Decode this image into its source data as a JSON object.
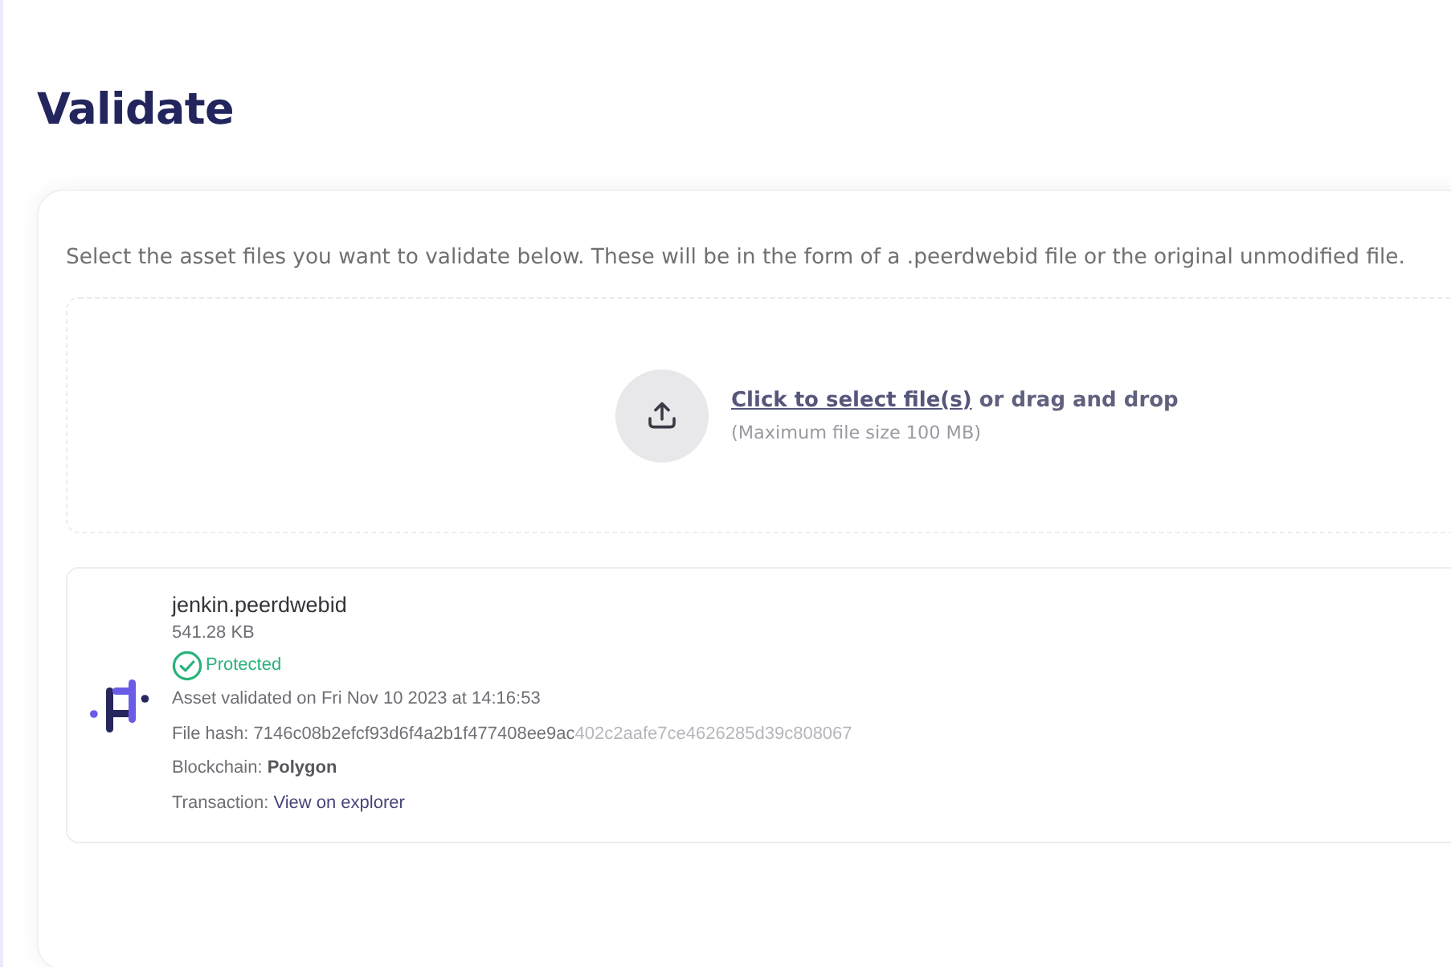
{
  "page": {
    "title": "Validate"
  },
  "upload": {
    "instructions": "Select the asset files you want to validate below. These will be in the form of a .peerdwebid file or the original unmodified file.",
    "link": "Click to select file(s)",
    "prompt": "or drag and drop",
    "limit": "(Maximum file size 100 MB)"
  },
  "files": [
    {
      "name": "jenkin.peerdwebid",
      "size": "541.28 KB",
      "status": {
        "kind": "protected",
        "label": "Protected"
      },
      "validated": "Asset validated on Fri Nov 10 2023 at 14:16:53",
      "hash_label": "File hash:",
      "hash": "7146c08b2efcf93d6f4a2b1f477408ee9ac402c2aafe7ce4626285d39c808067",
      "blockchain": "Blockchain: **Polygon**",
      "transaction_label": "Transaction:",
      "transaction_link": "View on explorer"
    }
  ]
}
